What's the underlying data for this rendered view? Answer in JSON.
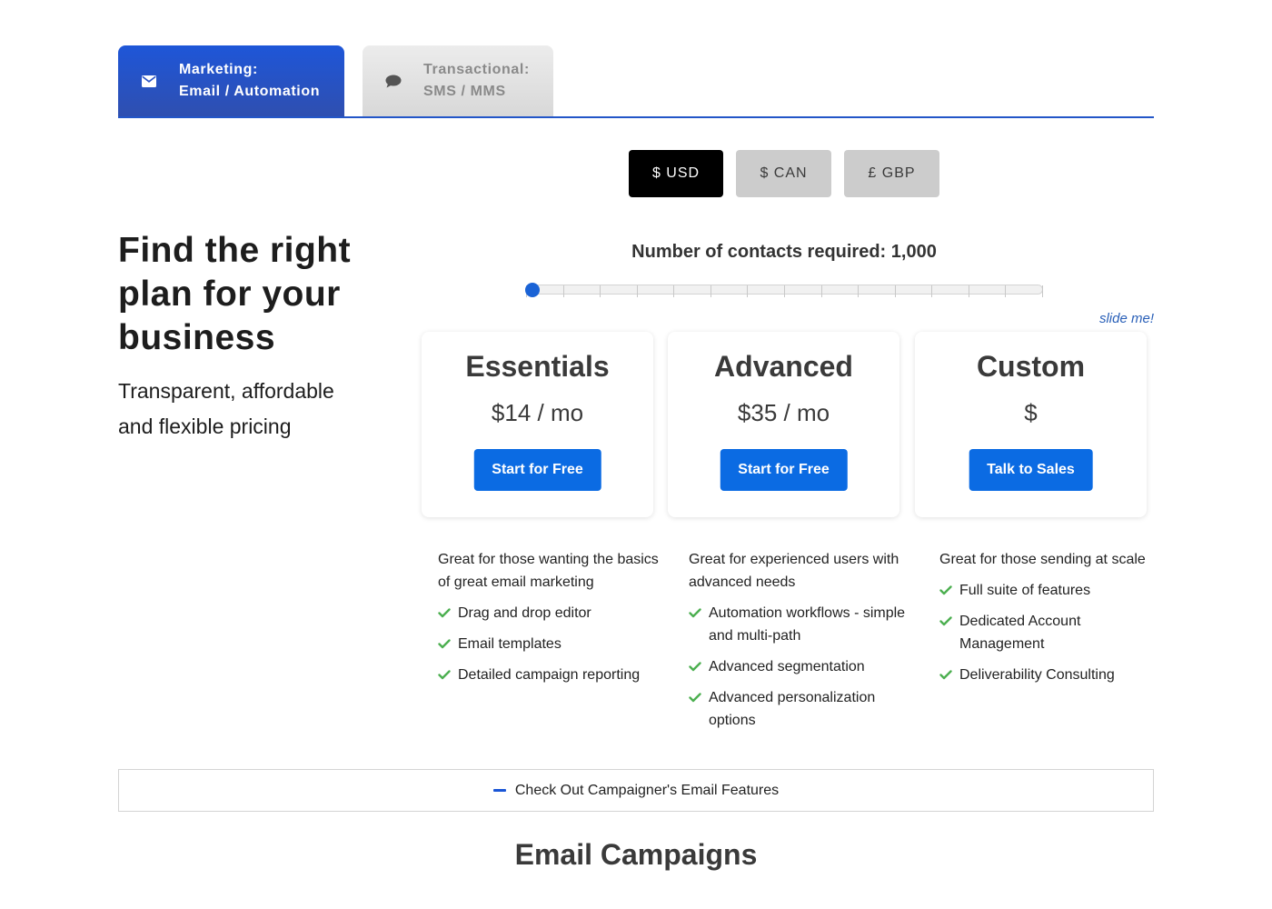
{
  "tabs": [
    {
      "line1": "Marketing:",
      "line2": "Email / Automation",
      "icon": "envelope-icon",
      "active": true
    },
    {
      "line1": "Transactional:",
      "line2": "SMS / MMS",
      "icon": "chat-bubble-icon",
      "active": false
    }
  ],
  "currency": {
    "options": [
      "$ USD",
      "$ CAN",
      "£ GBP"
    ],
    "selected": "$ USD"
  },
  "hero": {
    "title": "Find the right plan for your business",
    "subtitle": "Transparent, affordable and flexible pricing"
  },
  "slider": {
    "label": "Number of contacts required: 1,000",
    "hint": "slide me!",
    "position_fraction": 0.0
  },
  "plans": [
    {
      "name": "Essentials",
      "price": "$14 / mo",
      "cta": "Start for Free",
      "description": "Great for those wanting the basics of great email marketing",
      "features": [
        "Drag and drop editor",
        "Email templates",
        "Detailed campaign reporting"
      ]
    },
    {
      "name": "Advanced",
      "price": "$35 / mo",
      "cta": "Start for Free",
      "description": "Great for experienced users with advanced needs",
      "features": [
        "Automation workflows - simple and multi-path",
        "Advanced segmentation",
        "Advanced personalization options"
      ]
    },
    {
      "name": "Custom",
      "price": "$",
      "cta": "Talk to Sales",
      "description": "Great for those sending at scale",
      "features": [
        "Full suite of features",
        "Dedicated Account Management",
        "Deliverability Consulting"
      ]
    }
  ],
  "accordion": {
    "label": "Check Out Campaigner's Email Features"
  },
  "section": {
    "title": "Email Campaigns"
  },
  "colors": {
    "primary": "#0b6be3",
    "tab_active": "#1e56d8",
    "check": "#4caf50"
  }
}
